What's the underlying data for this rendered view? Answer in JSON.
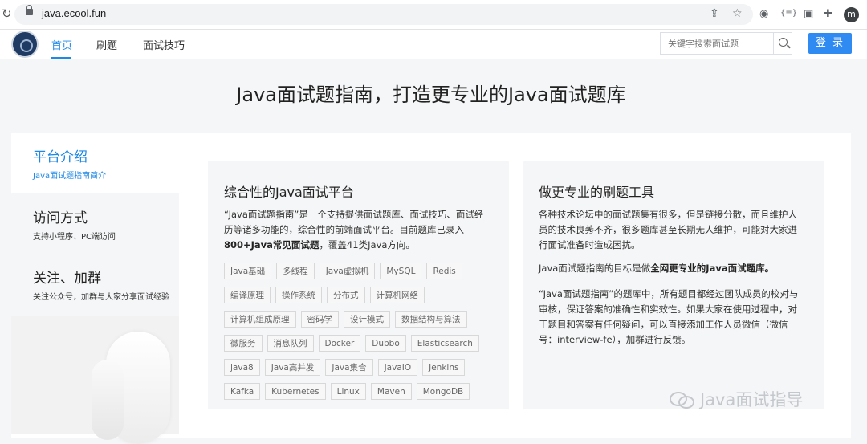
{
  "browser": {
    "url": "java.ecool.fun",
    "profile_initial": "m",
    "icons": [
      "reload-icon",
      "lock-icon",
      "share-icon",
      "bookmark-star-icon",
      "extension-icon",
      "profile-avatar",
      "menu-icon"
    ]
  },
  "header": {
    "nav": [
      {
        "label": "首页",
        "active": true
      },
      {
        "label": "刷题",
        "active": false
      },
      {
        "label": "面试技巧",
        "active": false
      }
    ],
    "search_placeholder": "关键字搜索面试题",
    "login_label": "登 录",
    "accent_color": "#1e88e5"
  },
  "headline": "Java面试题指南，打造更专业的Java面试题库",
  "sidebar": {
    "items": [
      {
        "title": "平台介绍",
        "subtitle": "Java面试题指南简介",
        "active": true
      },
      {
        "title": "访问方式",
        "subtitle": "支持小程序、PC端访问",
        "active": false
      },
      {
        "title": "关注、加群",
        "subtitle": "关注公众号，加群与大家分享面试经验",
        "active": false
      }
    ]
  },
  "panel1": {
    "title": "综合性的Java面试平台",
    "text_1": "“Java面试题指南”是一个支持提供面试题库、面试技巧、面试经",
    "text_2": "历等诸多功能的，综合性的前端面试平台。目前题库已录入",
    "text_3_bold": "800+Java常见面试题",
    "text_3_rest": "，覆盖41类Java方向。",
    "tags": [
      "Java基础",
      "多线程",
      "Java虚拟机",
      "MySQL",
      "Redis",
      "编译原理",
      "操作系统",
      "分布式",
      "计算机网络",
      "计算机组成原理",
      "密码学",
      "设计模式",
      "数据结构与算法",
      "微服务",
      "消息队列",
      "Docker",
      "Dubbo",
      "Elasticsearch",
      "java8",
      "Java高并发",
      "Java集合",
      "JavaIO",
      "Jenkins",
      "Kafka",
      "Kubernetes",
      "Linux",
      "Maven",
      "MongoDB"
    ]
  },
  "panel2": {
    "title": "做更专业的刷题工具",
    "para1_1": "各种技术论坛中的面试题集有很多，但是链接分散，而且维护人",
    "para1_2": "员的技术良莠不齐，很多题库甚至长期无人维护，可能对大家进",
    "para1_3": "行面试准备时造成困扰。",
    "para2_prefix": "Java面试题指南的目标是做",
    "para2_bold": "全网更专业的Java面试题库。",
    "para3_1": "“Java面试题指南”的题库中，所有题目都经过团队成员的校对与",
    "para3_2": "审核，保证答案的准确性和实效性。如果大家在使用过程中，对",
    "para3_3": "于题目和答案有任何疑问，可以直接添加工作人员微信（微信",
    "para3_4": "号：interview-fe），加群进行反馈。"
  },
  "watermark": "Java面试指导"
}
